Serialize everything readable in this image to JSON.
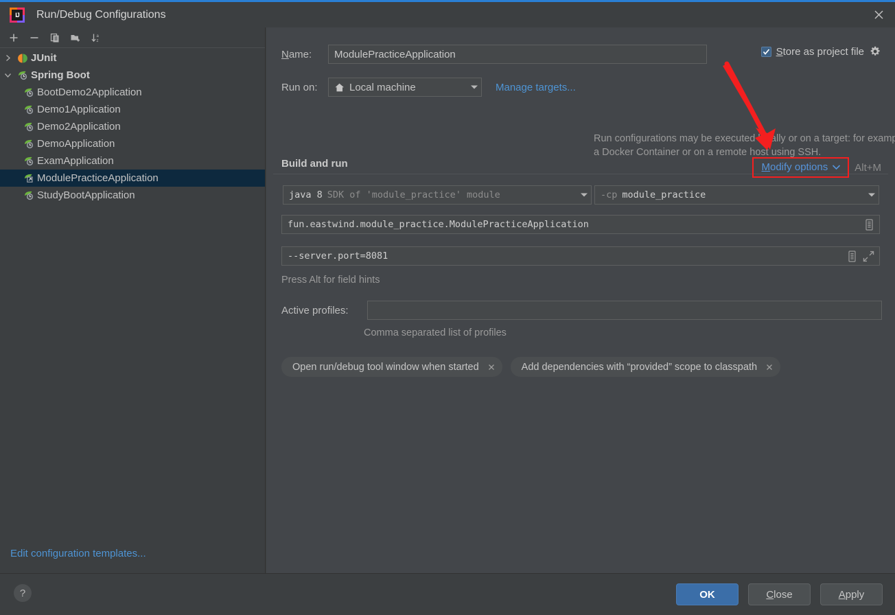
{
  "window": {
    "title": "Run/Debug Configurations",
    "app_icon": "intellij-idea-icon",
    "close_icon": "close-icon",
    "accent_blue": "#2a7fd4",
    "annotation_red": "#f41f1f"
  },
  "sidebar": {
    "toolbar": [
      {
        "name": "add-configuration-button",
        "icon": "plus-icon",
        "label": "+"
      },
      {
        "name": "remove-configuration-button",
        "icon": "minus-icon",
        "label": "−"
      },
      {
        "name": "copy-configuration-button",
        "icon": "copy-icon",
        "label": "Copy"
      },
      {
        "name": "new-folder-button",
        "icon": "new-folder-icon",
        "label": "New Folder"
      },
      {
        "name": "sort-configurations-button",
        "icon": "sort-alphabetically-icon",
        "label": "Sort"
      }
    ],
    "tree": [
      {
        "label": "JUnit",
        "type": "group",
        "expanded": false,
        "icon": "junit-icon"
      },
      {
        "label": "Spring Boot",
        "type": "group",
        "expanded": true,
        "icon": "spring-boot-icon"
      },
      {
        "label": "BootDemo2Application",
        "type": "child",
        "icon": "spring-boot-run-icon"
      },
      {
        "label": "Demo1Application",
        "type": "child",
        "icon": "spring-boot-run-icon"
      },
      {
        "label": "Demo2Application",
        "type": "child",
        "icon": "spring-boot-run-icon"
      },
      {
        "label": "DemoApplication",
        "type": "child",
        "icon": "spring-boot-run-icon"
      },
      {
        "label": "ExamApplication",
        "type": "child",
        "icon": "spring-boot-run-icon"
      },
      {
        "label": "ModulePracticeApplication",
        "type": "child",
        "icon": "spring-boot-share-icon",
        "selected": true
      },
      {
        "label": "StudyBootApplication",
        "type": "child",
        "icon": "spring-boot-run-icon"
      }
    ],
    "edit_templates_link": "Edit configuration templates..."
  },
  "form": {
    "name_label": "Name:",
    "name_label_mnemonic": "N",
    "name_value": "ModulePracticeApplication",
    "store_as_project_file_label": "Store as project file",
    "store_as_project_file_mnemonic": "S",
    "store_as_project_file_checked": true,
    "store_gear_icon": "gear-icon",
    "run_on_label": "Run on:",
    "run_on_value": "Local machine",
    "run_on_icon": "home-icon",
    "manage_targets_link": "Manage targets...",
    "run_on_description": "Run configurations may be executed locally or on a target: for example in a Docker Container or on a remote host using SSH.",
    "build_and_run_title": "Build and run",
    "modify_options_label": "Modify options",
    "modify_options_mnemonic": "M",
    "modify_options_shortcut": "Alt+M",
    "jdk_value_bright": "java 8",
    "jdk_value_dim": "SDK of 'module_practice' module",
    "classpath_value_dim": "-cp",
    "classpath_value_bright": "module_practice",
    "main_class_value": "fun.eastwind.module_practice.ModulePracticeApplication",
    "main_class_icon": "expand-list-icon",
    "program_arguments_value": "--server.port=8081",
    "program_arguments_icon": "expand-list-icon",
    "program_arguments_expand_icon": "expand-editor-icon",
    "alt_hint": "Press Alt for field hints",
    "active_profiles_label": "Active profiles:",
    "active_profiles_value": "",
    "active_profiles_hint": "Comma separated list of profiles",
    "option_chips": [
      {
        "label": "Open run/debug tool window when started",
        "remove_icon": "close-icon"
      },
      {
        "label": "Add dependencies with “provided” scope to classpath",
        "remove_icon": "close-icon"
      }
    ]
  },
  "footer": {
    "help_label": "?",
    "help_icon": "help-icon",
    "ok_label": "OK",
    "close_label": "Close",
    "close_mnemonic": "C",
    "apply_label": "Apply",
    "apply_mnemonic": "A"
  }
}
